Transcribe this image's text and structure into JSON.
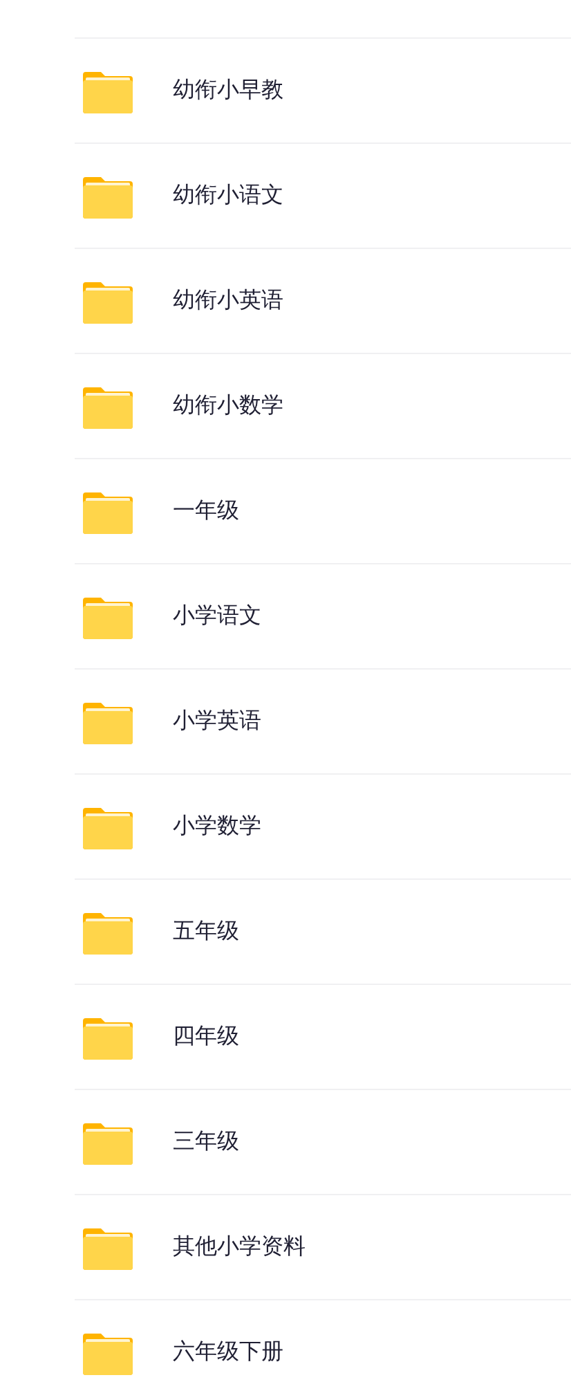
{
  "folders": [
    {
      "name": "幼衔小早教"
    },
    {
      "name": "幼衔小语文"
    },
    {
      "name": "幼衔小英语"
    },
    {
      "name": "幼衔小数学"
    },
    {
      "name": "一年级"
    },
    {
      "name": "小学语文"
    },
    {
      "name": "小学英语"
    },
    {
      "name": "小学数学"
    },
    {
      "name": "五年级"
    },
    {
      "name": "四年级"
    },
    {
      "name": "三年级"
    },
    {
      "name": "其他小学资料"
    },
    {
      "name": "六年级下册"
    }
  ]
}
